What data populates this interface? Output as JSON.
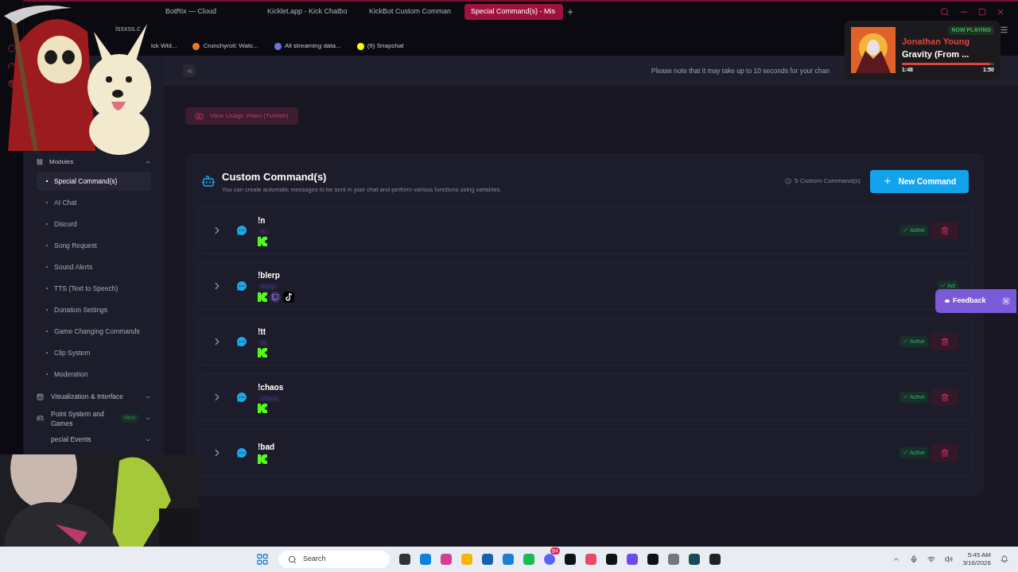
{
  "browser": {
    "tabs": [
      {
        "title": "BotRix — Cloud",
        "selected": false
      },
      {
        "title": "Kicklet.app - Kick Chatbo",
        "selected": false
      },
      {
        "title": "KickBot Custom Comman",
        "selected": false
      },
      {
        "title": "Special Command(s) - Mis",
        "selected": true
      }
    ],
    "address": "issxss.c",
    "bookmarks": [
      "ick Wid...",
      "Crunchyroll: Watc...",
      "All streaming data...",
      "(9) Snapchat"
    ]
  },
  "page": {
    "notice": "Please note that it may take up to 10 seconds for your chan",
    "usage_button": "View Usage Video (Turkish)"
  },
  "sidebar": {
    "section": {
      "label": "Modules",
      "expanded": true
    },
    "items": [
      {
        "label": "Special Command(s)",
        "selected": true
      },
      {
        "label": "AI Chat",
        "selected": false
      },
      {
        "label": "Discord",
        "selected": false
      },
      {
        "label": "Song Request",
        "selected": false
      },
      {
        "label": "Sound Alerts",
        "selected": false
      },
      {
        "label": "TTS (Text to Speech)",
        "selected": false
      },
      {
        "label": "Donation Settings",
        "selected": false
      },
      {
        "label": "Game Changing Commands",
        "selected": false
      },
      {
        "label": "Clip System",
        "selected": false
      },
      {
        "label": "Moderation",
        "selected": false
      }
    ],
    "groups": [
      {
        "label": "Visualization & Interface",
        "expanded": false
      },
      {
        "label": "Point System and Games",
        "badge": "New",
        "expanded": false
      },
      {
        "label": "pecial Events",
        "expanded": false
      }
    ]
  },
  "panel": {
    "title": "Custom Command(s)",
    "subtitle": "You can create automatic messages to be sent in your chat and perform various functions using variables.",
    "count": "5 Custom Command(s)",
    "new_button": "New Command",
    "commands": [
      {
        "name": "!n",
        "alias": "!n",
        "platforms": [
          {
            "kind": "kick"
          }
        ],
        "status": "Active",
        "active": true
      },
      {
        "name": "!blerp",
        "alias": "!blerp",
        "platforms": [
          {
            "kind": "kick"
          },
          {
            "kind": "twitch"
          },
          {
            "kind": "tiktok"
          }
        ],
        "status": "Act",
        "active": true
      },
      {
        "name": "!tt",
        "alias": "!tt",
        "platforms": [
          {
            "kind": "kick"
          }
        ],
        "status": "Active",
        "active": true
      },
      {
        "name": "!chaos",
        "alias": "!chaos",
        "platforms": [
          {
            "kind": "kick"
          }
        ],
        "status": "Active",
        "active": true
      },
      {
        "name": "!bad",
        "platforms": [
          {
            "kind": "kick"
          }
        ],
        "status": "Active",
        "active": true
      }
    ]
  },
  "now_playing": {
    "label": "NOW PLAYING",
    "artist": "Jonathan Young",
    "track": "Gravity (From ...",
    "elapsed": "1:48",
    "total": "1:50",
    "level": 0.96
  },
  "feedback": {
    "label": "Feedback"
  },
  "taskbar": {
    "search": "Search",
    "badge": "9+",
    "time": "5:45 AM",
    "date": "3/16/2026"
  }
}
